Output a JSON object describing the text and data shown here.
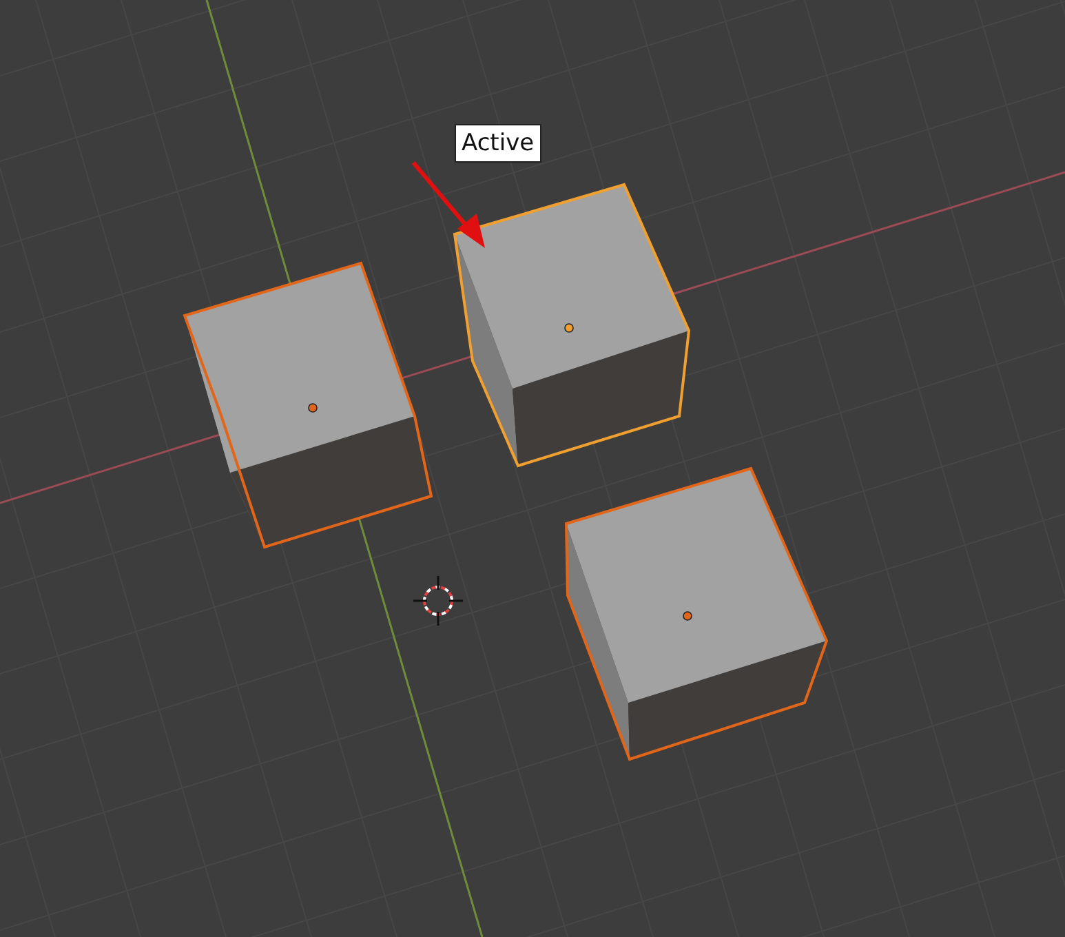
{
  "annotation": {
    "label": "Active"
  },
  "objects": [
    {
      "selected": true,
      "active": false
    },
    {
      "selected": true,
      "active": true
    },
    {
      "selected": true,
      "active": false
    }
  ]
}
